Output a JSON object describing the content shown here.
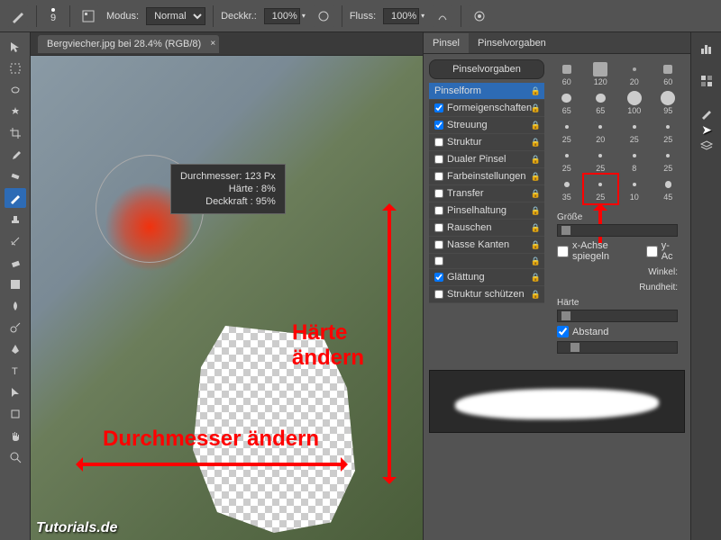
{
  "toolbar": {
    "brush_size": "9",
    "modus_label": "Modus:",
    "modus_value": "Normal",
    "deckk_label": "Deckkr.:",
    "deckk_value": "100%",
    "fluss_label": "Fluss:",
    "fluss_value": "100%"
  },
  "document": {
    "tab_title": "Bergviecher.jpg bei 28.4% (RGB/8)"
  },
  "tooltip": {
    "line1": "Durchmesser: 123 Px",
    "line2": "Härte :      8%",
    "line3": "Deckkraft :   95%"
  },
  "overlays": {
    "harte": "Härte ändern",
    "durchmesser": "Durchmesser ändern",
    "brand": "Tutorials.de"
  },
  "panel": {
    "tab_pinsel": "Pinsel",
    "tab_vorgaben": "Pinselvorgaben",
    "btn_vorgaben": "Pinselvorgaben",
    "shape_items": [
      {
        "label": "Pinselform",
        "checked": false,
        "header": true
      },
      {
        "label": "Formeigenschaften",
        "checked": true
      },
      {
        "label": "Streuung",
        "checked": true
      },
      {
        "label": "Struktur",
        "checked": false
      },
      {
        "label": "Dualer Pinsel",
        "checked": false
      },
      {
        "label": "Farbeinstellungen",
        "checked": false
      },
      {
        "label": "Transfer",
        "checked": false
      },
      {
        "label": "Pinselhaltung",
        "checked": false
      },
      {
        "label": "Rauschen",
        "checked": false
      },
      {
        "label": "Nasse Kanten",
        "checked": false
      },
      {
        "label": "",
        "checked": false
      },
      {
        "label": "Glättung",
        "checked": true
      },
      {
        "label": "Struktur schützen",
        "checked": false
      }
    ],
    "brush_sizes": [
      "60",
      "120",
      "20",
      "60",
      "65",
      "65",
      "100",
      "95",
      "25",
      "20",
      "25",
      "25",
      "25",
      "25",
      "8",
      "25",
      "35",
      "25",
      "10",
      "45"
    ],
    "selected_brush_index": 17,
    "grosse_label": "Größe",
    "x_spiegeln": "x-Achse spiegeln",
    "y_spiegeln": "y-Ac",
    "winkel": "Winkel:",
    "rundheit": "Rundheit:",
    "harte": "Härte",
    "abstand": "Abstand"
  }
}
